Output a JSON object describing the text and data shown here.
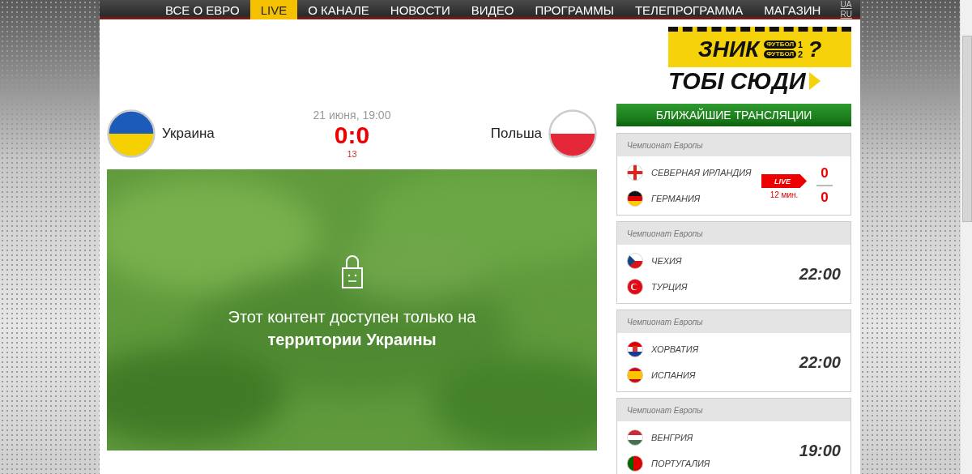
{
  "nav": {
    "items": [
      {
        "label": "ВСЕ О ЕВРО",
        "selected": false
      },
      {
        "label": "LIVE",
        "selected": true
      },
      {
        "label": "О КАНАЛЕ",
        "selected": false
      },
      {
        "label": "НОВОСТИ",
        "selected": false
      },
      {
        "label": "ВИДЕО",
        "selected": false
      },
      {
        "label": "ПРОГРАММЫ",
        "selected": false
      },
      {
        "label": "ТЕЛЕПРОГРАММА",
        "selected": false
      },
      {
        "label": "МАГАЗИН",
        "selected": false
      }
    ],
    "languages": [
      {
        "label": "UA"
      },
      {
        "label": "RU"
      }
    ]
  },
  "ad": {
    "line1": "ЗНИК",
    "channel_1": "ФУТБОЛ",
    "num_1": "1",
    "channel_2": "ФУТБОЛ",
    "num_2": "2",
    "mark": "?",
    "line2": "ТОБІ СЮДИ"
  },
  "match": {
    "home": "Украина",
    "away": "Польша",
    "date": "21 июня, 19:00",
    "score": "0:0",
    "minute": "13"
  },
  "player": {
    "message": "Этот контент доступен только на **территории Украины**"
  },
  "schedule": {
    "title": "БЛИЖАЙШИЕ ТРАНСЛЯЦИИ",
    "cards": [
      {
        "kind": "live",
        "tournament": "Чемпионат Европы",
        "teams": [
          "СЕВЕРНАЯ ИРЛАНДИЯ",
          "ГЕРМАНИЯ"
        ],
        "badge": "LIVE",
        "minute": "12 мин.",
        "scores": [
          "0",
          "0"
        ]
      },
      {
        "kind": "scheduled",
        "tournament": "Чемпионат Европы",
        "teams": [
          "ЧЕХИЯ",
          "ТУРЦИЯ"
        ],
        "time": "22:00"
      },
      {
        "kind": "scheduled",
        "tournament": "Чемпионат Европы",
        "teams": [
          "ХОРВАТИЯ",
          "ИСПАНИЯ"
        ],
        "time": "22:00"
      },
      {
        "kind": "scheduled",
        "tournament": "Чемпионат Европы",
        "teams": [
          "ВЕНГРИЯ",
          "ПОРТУГАЛИЯ"
        ],
        "time": "19:00"
      }
    ]
  }
}
